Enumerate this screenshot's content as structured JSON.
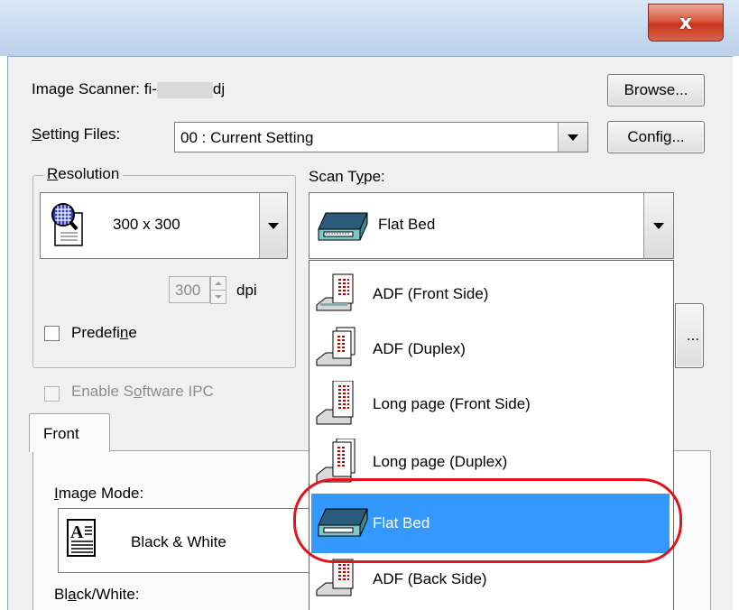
{
  "window": {
    "close_label": "x"
  },
  "scanner": {
    "label": "Image Scanner: fi-",
    "suffix": "dj",
    "browse": "Browse..."
  },
  "setting": {
    "label_u": "S",
    "label_rest": "etting Files:",
    "value": "00 : Current Setting",
    "config": "Config..."
  },
  "resolution": {
    "label_u": "R",
    "label_rest": "esolution",
    "value": "300 x 300",
    "dpi_value": "300",
    "dpi_unit": "dpi",
    "predefine_pre": "Predefi",
    "predefine_u": "n",
    "predefine_post": "e"
  },
  "scan_type": {
    "label_pre": "Scan T",
    "label_u": "y",
    "label_post": "pe:",
    "value": "Flat Bed",
    "options": [
      "ADF (Front Side)",
      "ADF (Duplex)",
      "Long page (Front Side)",
      "Long page (Duplex)",
      "Flat Bed",
      "ADF (Back Side)"
    ],
    "selected": "Flat Bed"
  },
  "ellipsis_button": "...",
  "ipc": {
    "pre": "Enable S",
    "u": "o",
    "post": "ftware IPC"
  },
  "tabs": {
    "front": "Front"
  },
  "image_mode": {
    "label_u": "I",
    "label_rest": "mage Mode:",
    "value": "Black & White"
  },
  "bw": {
    "pre": "Bl",
    "u": "a",
    "post": "ck/White:"
  },
  "colors": {
    "selection": "#3399ff",
    "highlight_ring": "#e0141c",
    "close": "#c8371d"
  },
  "icons": {
    "resolution": "magnifier-page-icon",
    "scan_type": "flatbed-scanner-icon",
    "image_mode": "text-page-icon"
  }
}
